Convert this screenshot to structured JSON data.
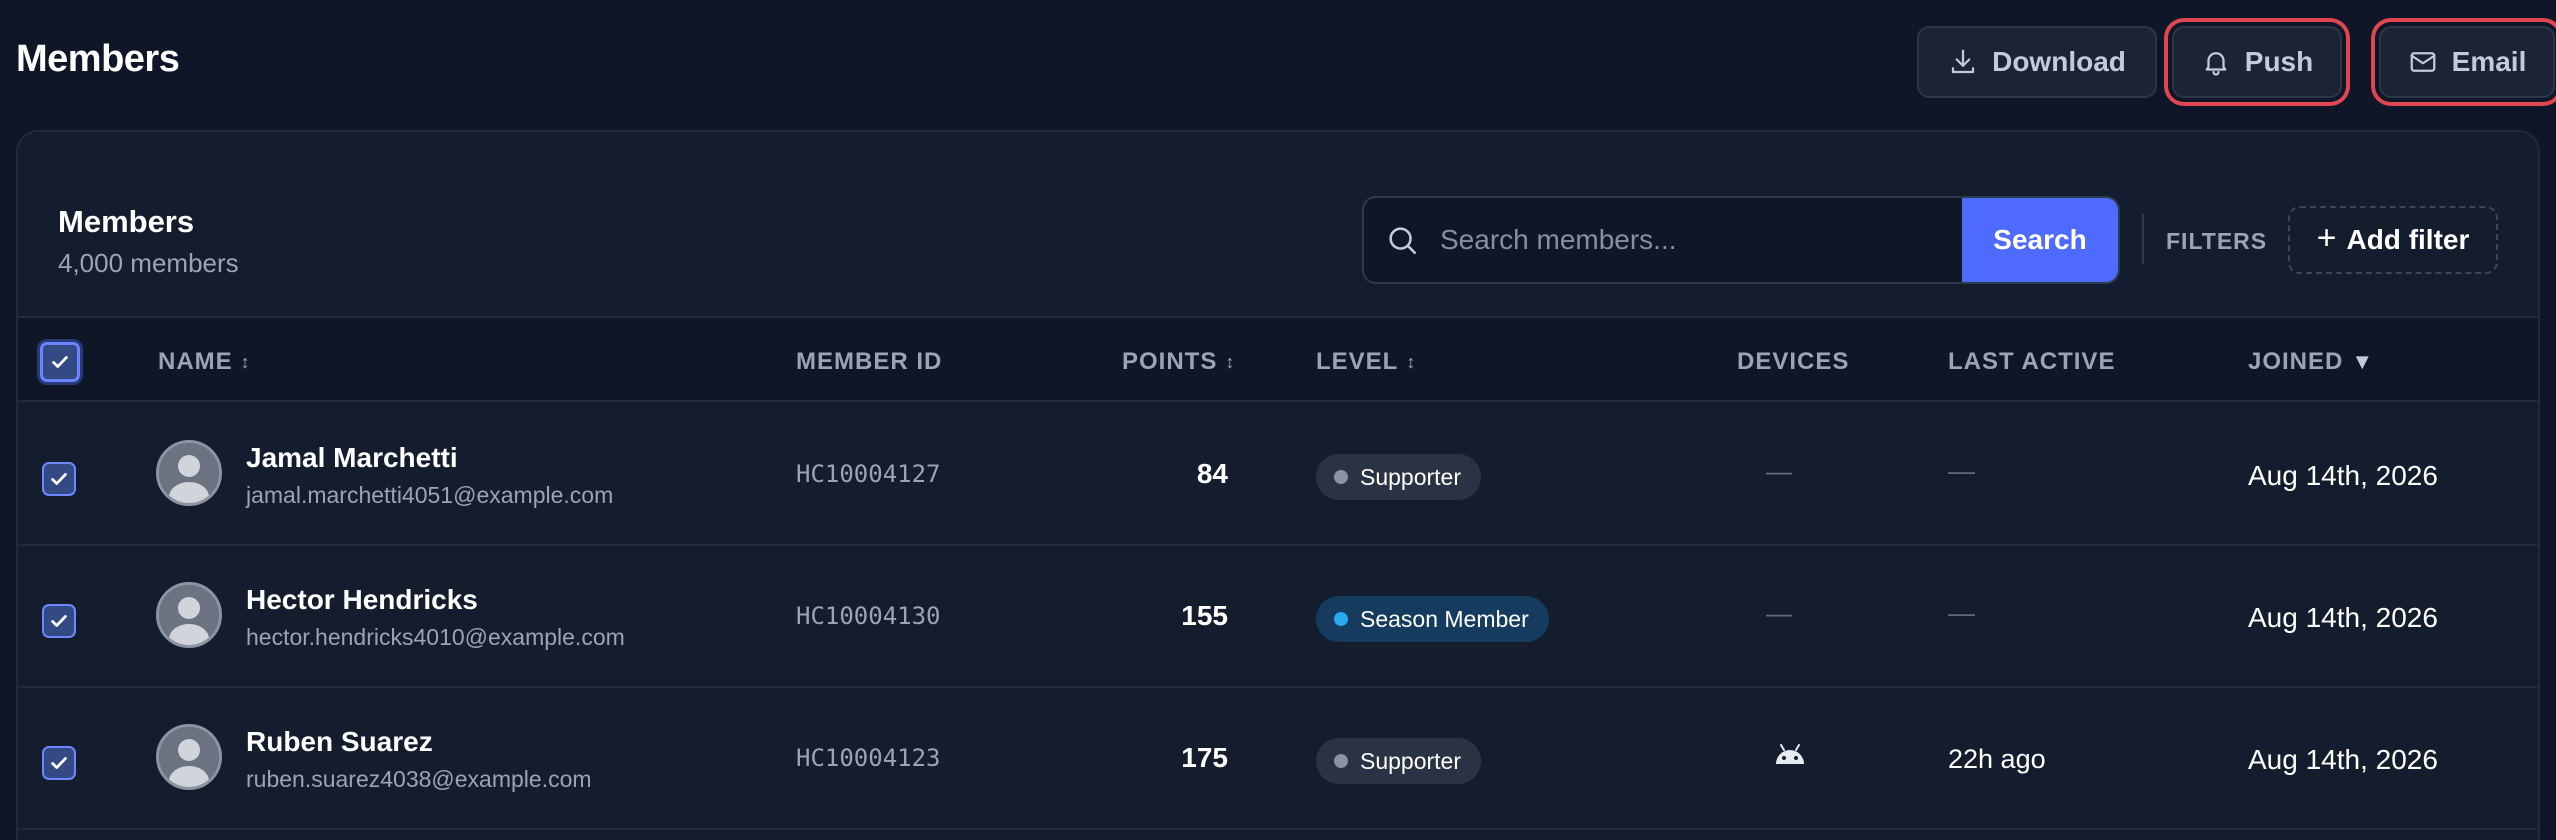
{
  "header": {
    "title": "Members",
    "download_label": "Download",
    "push_label": "Push",
    "email_label": "Email"
  },
  "card": {
    "title": "Members",
    "subtitle": "4,000 members",
    "search_placeholder": "Search members...",
    "search_button": "Search",
    "filters_label": "FILTERS",
    "add_filter_label": "Add filter"
  },
  "columns": {
    "name": "NAME",
    "member_id": "MEMBER ID",
    "points": "POINTS",
    "level": "LEVEL",
    "devices": "DEVICES",
    "last_active": "LAST ACTIVE",
    "joined": "JOINED"
  },
  "rows": [
    {
      "name": "Jamal Marchetti",
      "email": "jamal.marchetti4051@example.com",
      "member_id": "HC10004127",
      "points": "84",
      "level": "Supporter",
      "devices": "—",
      "last_active": "—",
      "joined": "Aug 14th, 2026",
      "checked": true
    },
    {
      "name": "Hector Hendricks",
      "email": "hector.hendricks4010@example.com",
      "member_id": "HC10004130",
      "points": "155",
      "level": "Season Member",
      "devices": "—",
      "last_active": "—",
      "joined": "Aug 14th, 2026",
      "checked": true
    },
    {
      "name": "Ruben Suarez",
      "email": "ruben.suarez4038@example.com",
      "member_id": "HC10004123",
      "points": "175",
      "level": "Supporter",
      "devices": "android-icon",
      "last_active": "22h ago",
      "joined": "Aug 14th, 2026",
      "checked": true
    }
  ],
  "colors": {
    "background": "#0e1627",
    "card": "#141d2d",
    "accent": "#4f6bff",
    "highlight_ring": "#e0464f",
    "season_dot": "#29a9ef",
    "supporter_dot": "#8a93a1"
  }
}
